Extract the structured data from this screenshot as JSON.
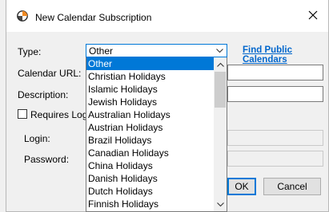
{
  "window": {
    "title": "New Calendar Subscription",
    "close_icon": "close-icon",
    "app_icon": "calendar-app-icon"
  },
  "form": {
    "type_label": "Type:",
    "type_value": "Other",
    "find_public_link": "Find Public Calendars",
    "calendar_url_label": "Calendar URL:",
    "calendar_url_value": "",
    "description_label": "Description:",
    "description_value": "",
    "requires_login_label": "Requires Login",
    "requires_login_checked": false,
    "login_label": "Login:",
    "login_value": "",
    "password_label": "Password:",
    "password_value": ""
  },
  "buttons": {
    "ok_label": "OK",
    "cancel_label": "Cancel"
  },
  "dropdown": {
    "selected": "Other",
    "options": [
      "Other",
      "Christian Holidays",
      "Islamic Holidays",
      "Jewish Holidays",
      "Australian Holidays",
      "Austrian Holidays",
      "Brazil Holidays",
      "Canadian Holidays",
      "China Holidays",
      "Danish Holidays",
      "Dutch Holidays",
      "Finnish Holidays"
    ]
  },
  "colors": {
    "accent": "#0078d7",
    "link": "#0066cc",
    "app_icon_orange": "#f08a24"
  }
}
